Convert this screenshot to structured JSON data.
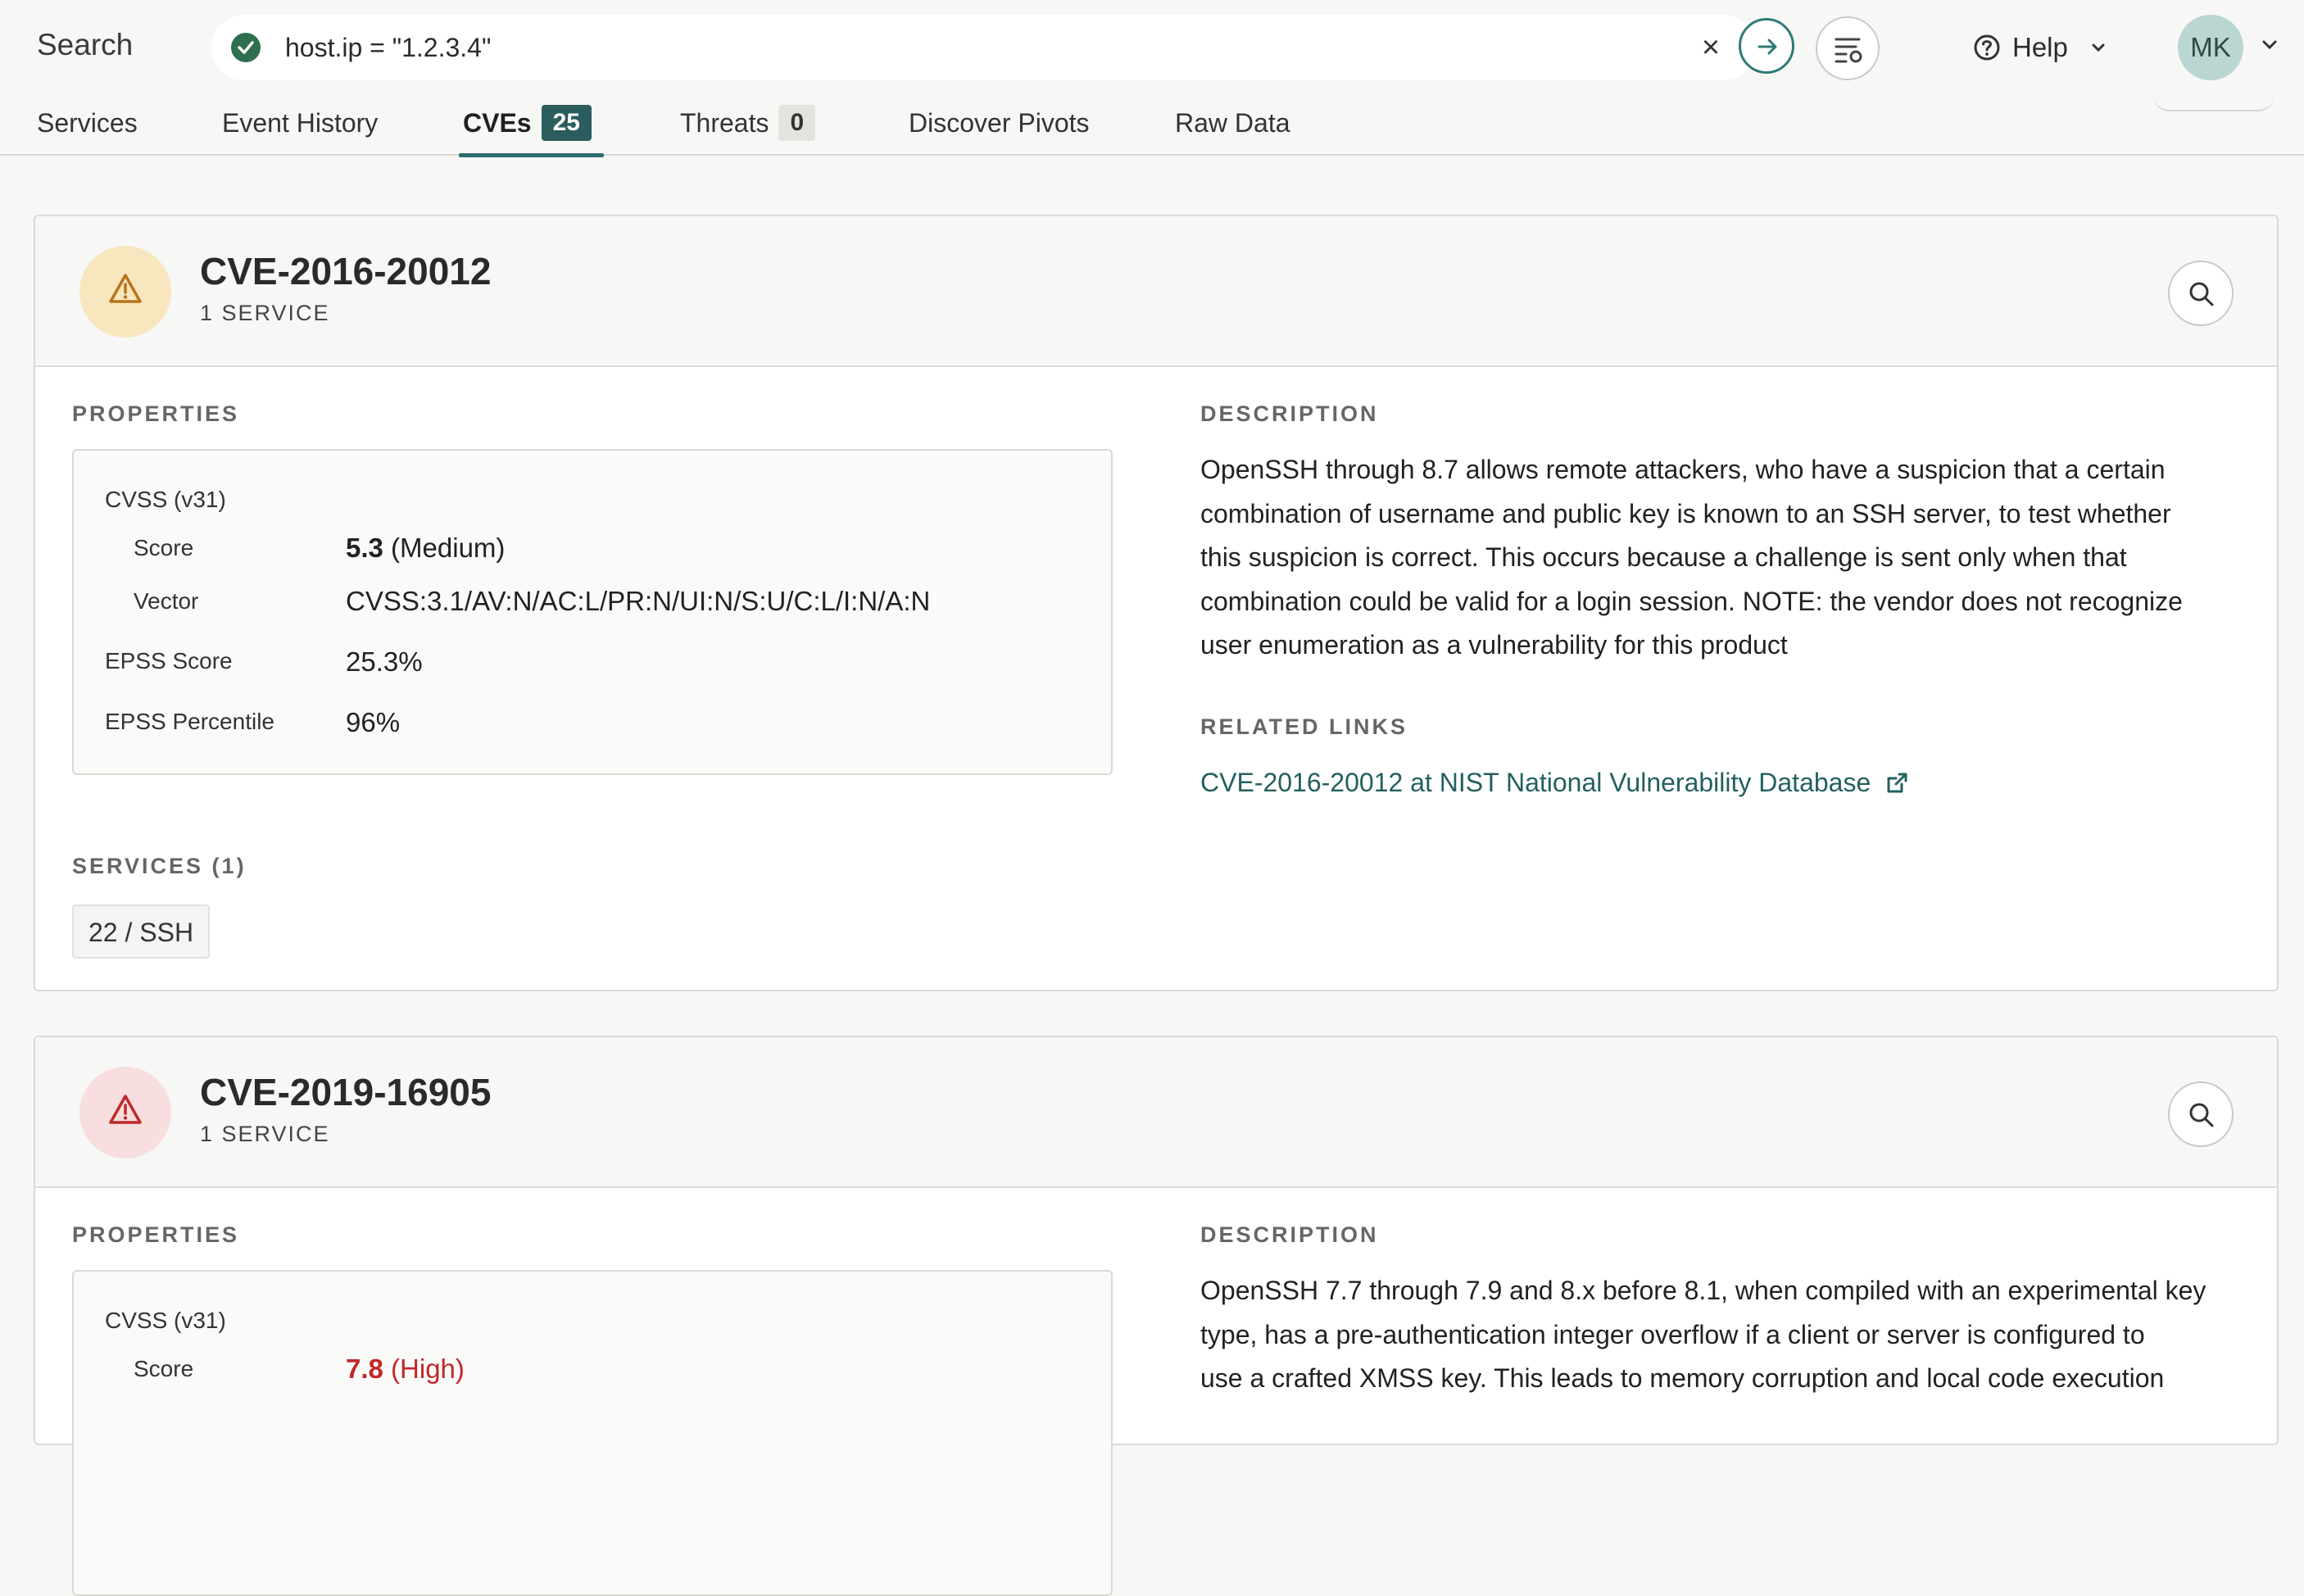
{
  "header": {
    "search_label": "Search",
    "query": "host.ip = \"1.2.3.4\"",
    "help_label": "Help",
    "avatar_initials": "MK"
  },
  "tabs": [
    {
      "label": "Services"
    },
    {
      "label": "Event History"
    },
    {
      "label": "CVEs",
      "count": "25",
      "active": true
    },
    {
      "label": "Threats",
      "count": "0"
    },
    {
      "label": "Discover Pivots"
    },
    {
      "label": "Raw Data"
    }
  ],
  "colors": {
    "accent": "#2b6e70",
    "severity_medium": "#c78a1e",
    "severity_high": "#c0292b"
  },
  "cves": [
    {
      "id": "CVE-2016-20012",
      "services_count_label": "1 SERVICE",
      "severity_icon": "warning-triangle-icon",
      "severity": "medium",
      "properties_label": "PROPERTIES",
      "cvss_label": "CVSS (v31)",
      "score_label": "Score",
      "score_value": "5.3",
      "score_rating": "(Medium)",
      "vector_label": "Vector",
      "vector_value": "CVSS:3.1/AV:N/AC:L/PR:N/UI:N/S:U/C:L/I:N/A:N",
      "epss_score_label": "EPSS Score",
      "epss_score_value": "25.3%",
      "epss_percentile_label": "EPSS Percentile",
      "epss_percentile_value": "96%",
      "description_label": "DESCRIPTION",
      "description_lines": [
        "OpenSSH through 8.7 allows remote attackers, who have a suspicion that a certain",
        "combination of username and public key is known to an SSH server, to test whether",
        "this suspicion is correct. This occurs because a challenge is sent only when that",
        "combination could be valid for a login session. NOTE: the vendor does not recognize",
        "user enumeration as a vulnerability for this product"
      ],
      "related_links_label": "RELATED LINKS",
      "related_link_text": "CVE-2016-20012 at NIST National Vulnerability Database",
      "services_label": "SERVICES (1)",
      "services": [
        "22 / SSH"
      ]
    },
    {
      "id": "CVE-2019-16905",
      "services_count_label": "1 SERVICE",
      "severity_icon": "warning-triangle-icon",
      "severity": "high",
      "properties_label": "PROPERTIES",
      "cvss_label": "CVSS (v31)",
      "score_label": "Score",
      "score_value": "7.8",
      "score_rating": "(High)",
      "description_label": "DESCRIPTION",
      "description_lines": [
        "OpenSSH 7.7 through 7.9 and 8.x before 8.1, when compiled with an experimental key",
        "type, has a pre-authentication integer overflow if a client or server is configured to",
        "use a crafted XMSS key. This leads to memory corruption and local code execution"
      ]
    }
  ]
}
